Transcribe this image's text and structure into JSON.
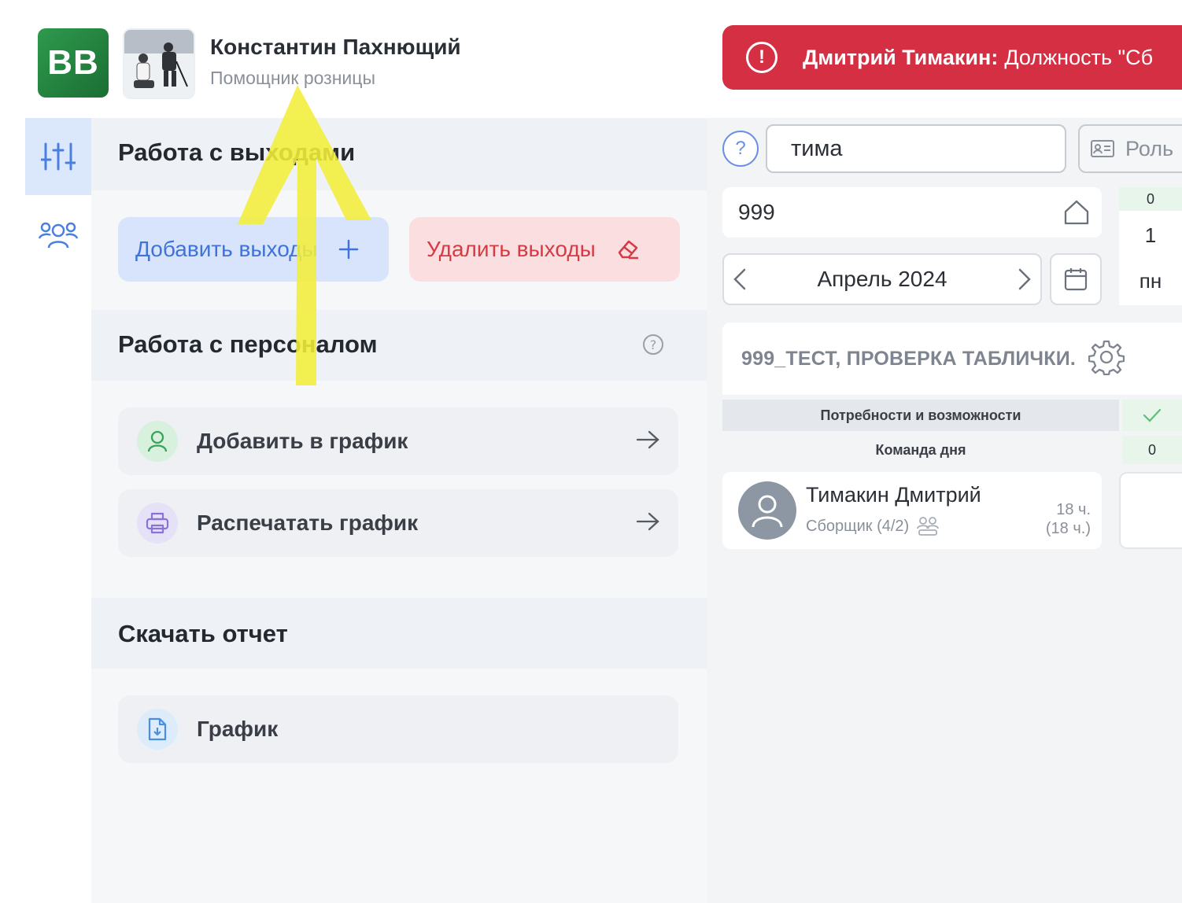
{
  "header": {
    "logo_text": "BB",
    "user_name": "Константин Пахнющий",
    "user_role": "Помощник розницы"
  },
  "alert": {
    "name": "Дмитрий Тимакин:",
    "message": "Должность \"Сб"
  },
  "sidebar": {
    "items": [
      {
        "icon": "sliders-icon",
        "active": true
      },
      {
        "icon": "users-icon",
        "active": false
      }
    ]
  },
  "panel": {
    "shifts": {
      "title": "Работа с выходами",
      "add_label": "Добавить выходы",
      "delete_label": "Удалить выходы"
    },
    "staff": {
      "title": "Работа с персоналом",
      "items": [
        {
          "label": "Добавить в график",
          "icon": "user-icon"
        },
        {
          "label": "Распечатать график",
          "icon": "printer-icon"
        }
      ]
    },
    "report": {
      "title": "Скачать отчет",
      "items": [
        {
          "label": "График",
          "icon": "file-download-icon"
        }
      ]
    }
  },
  "toolbar": {
    "help_text": "?",
    "search_value": "тима",
    "roles_label": "Роль"
  },
  "shop": {
    "code": "999"
  },
  "calendar": {
    "month": "Апрель 2024",
    "day_total": "0",
    "day_number": "1",
    "day_name": "пн"
  },
  "store": {
    "name": "999_ТЕСТ, ПРОВЕРКА ТАБЛИЧКИ."
  },
  "rows": {
    "needs_label": "Потребности и возможности",
    "team_label": "Команда дня",
    "team_value": "0"
  },
  "employee": {
    "name": "Тимакин Дмитрий",
    "role": "Сборщик (4/2)",
    "hours": "18 ч.",
    "hours_total": "(18 ч.)"
  },
  "colors": {
    "accent": "#3f73d8",
    "danger": "#d42f43",
    "brand": "#2e9a4d",
    "annotation": "#f3ee3a"
  }
}
